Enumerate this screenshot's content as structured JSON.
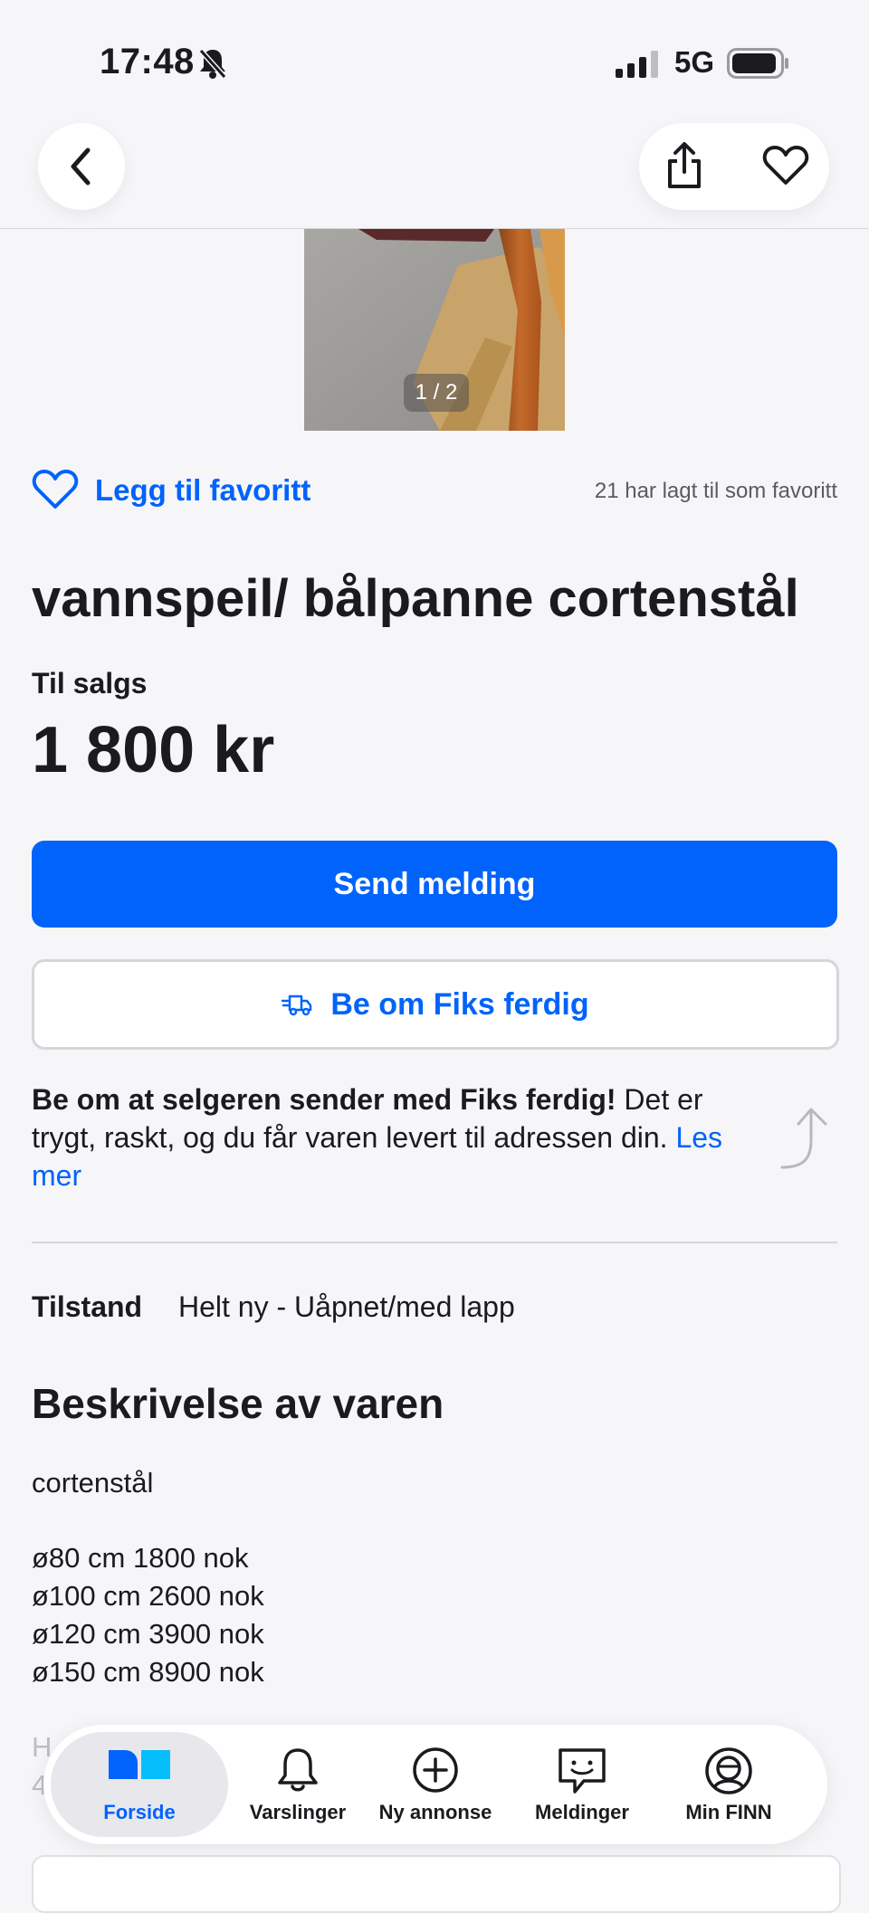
{
  "status": {
    "time": "17:48",
    "network": "5G"
  },
  "listing": {
    "photo_counter": "1 / 2",
    "favorite_label": "Legg til favoritt",
    "favorite_count_text": "21 har lagt til som favoritt",
    "title": "vannspeil/ bålpanne cortenstål",
    "sale_label": "Til salgs",
    "price": "1 800 kr"
  },
  "actions": {
    "send_message": "Send melding",
    "fiks_ferdig": "Be om Fiks ferdig"
  },
  "info": {
    "bold": "Be om at selgeren sender med Fiks ferdig!",
    "text": " Det er trygt, raskt, og du får varen levert til adressen din. ",
    "link": "Les mer"
  },
  "condition": {
    "label": "Tilstand",
    "value": "Helt ny - Uåpnet/med lapp"
  },
  "description": {
    "heading": "Beskrivelse av varen",
    "material": "cortenstål",
    "sizes": [
      "ø80 cm 1800 nok",
      "ø100 cm 2600 nok",
      "ø120 cm 3900 nok",
      "ø150 cm 8900 nok"
    ],
    "faded_line_1": "H",
    "faded_line_2": "4"
  },
  "tabbar": {
    "items": [
      {
        "label": "Forside",
        "icon": "home-icon"
      },
      {
        "label": "Varslinger",
        "icon": "bell-icon"
      },
      {
        "label": "Ny annonse",
        "icon": "plus-circle-icon"
      },
      {
        "label": "Meldinger",
        "icon": "chat-icon"
      },
      {
        "label": "Min FINN",
        "icon": "profile-icon"
      }
    ]
  },
  "colors": {
    "accent": "#0063fb",
    "background": "#f6f6f8"
  }
}
